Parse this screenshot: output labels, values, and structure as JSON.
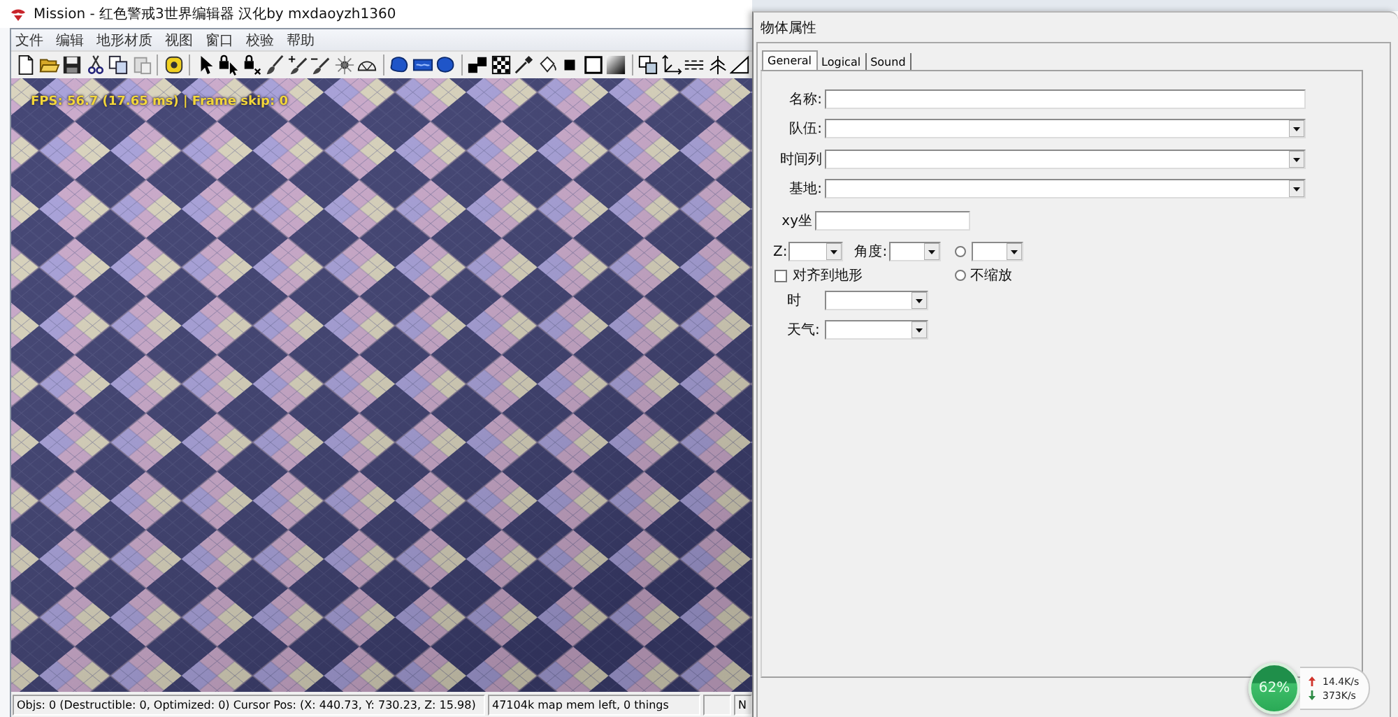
{
  "window": {
    "title": "Mission - 红色警戒3世界编辑器 汉化by mxdaoyzh1360"
  },
  "menu": [
    "文件",
    "编辑",
    "地形材质",
    "视图",
    "窗口",
    "校验",
    "帮助"
  ],
  "viewport": {
    "stats": "FPS: 56.7 (17.65 ms) | Frame skip: 0"
  },
  "status_bar": {
    "object_info": "Objs: 0 (Destructible: 0, Optimized: 0) Cursor Pos: (X: 440.73, Y: 730.23, Z: 15.98)",
    "memory": "47104k map mem left, 0 things",
    "pane_4": "N"
  },
  "properties_panel": {
    "title": "物体属性",
    "tabs": [
      {
        "label": "General",
        "selected": true
      },
      {
        "label": "Logical",
        "selected": false
      },
      {
        "label": "Sound",
        "selected": false
      }
    ],
    "fields": [
      {
        "kind": "text",
        "label": "名称:"
      },
      {
        "kind": "dropdown",
        "label": "队伍:"
      },
      {
        "kind": "dropdown",
        "label": "时间列"
      },
      {
        "kind": "dropdown",
        "label": "基地:"
      },
      {
        "kind": "coord",
        "label": "xy坐"
      }
    ],
    "z_label": "Z:",
    "angle_label": "角度:",
    "radios": [
      {
        "selected": false
      },
      {
        "label": "不缩放",
        "selected": false
      }
    ],
    "snap_checkbox": {
      "label": "对齐到地形",
      "checked": false
    },
    "bottom_fields": [
      {
        "kind": "short_dropdown",
        "label": "时"
      },
      {
        "kind": "short_dropdown",
        "label": "天气:"
      }
    ]
  },
  "memory_ball": {
    "percent": "62%",
    "upload": "14.4K/s",
    "download": "373K/s"
  }
}
